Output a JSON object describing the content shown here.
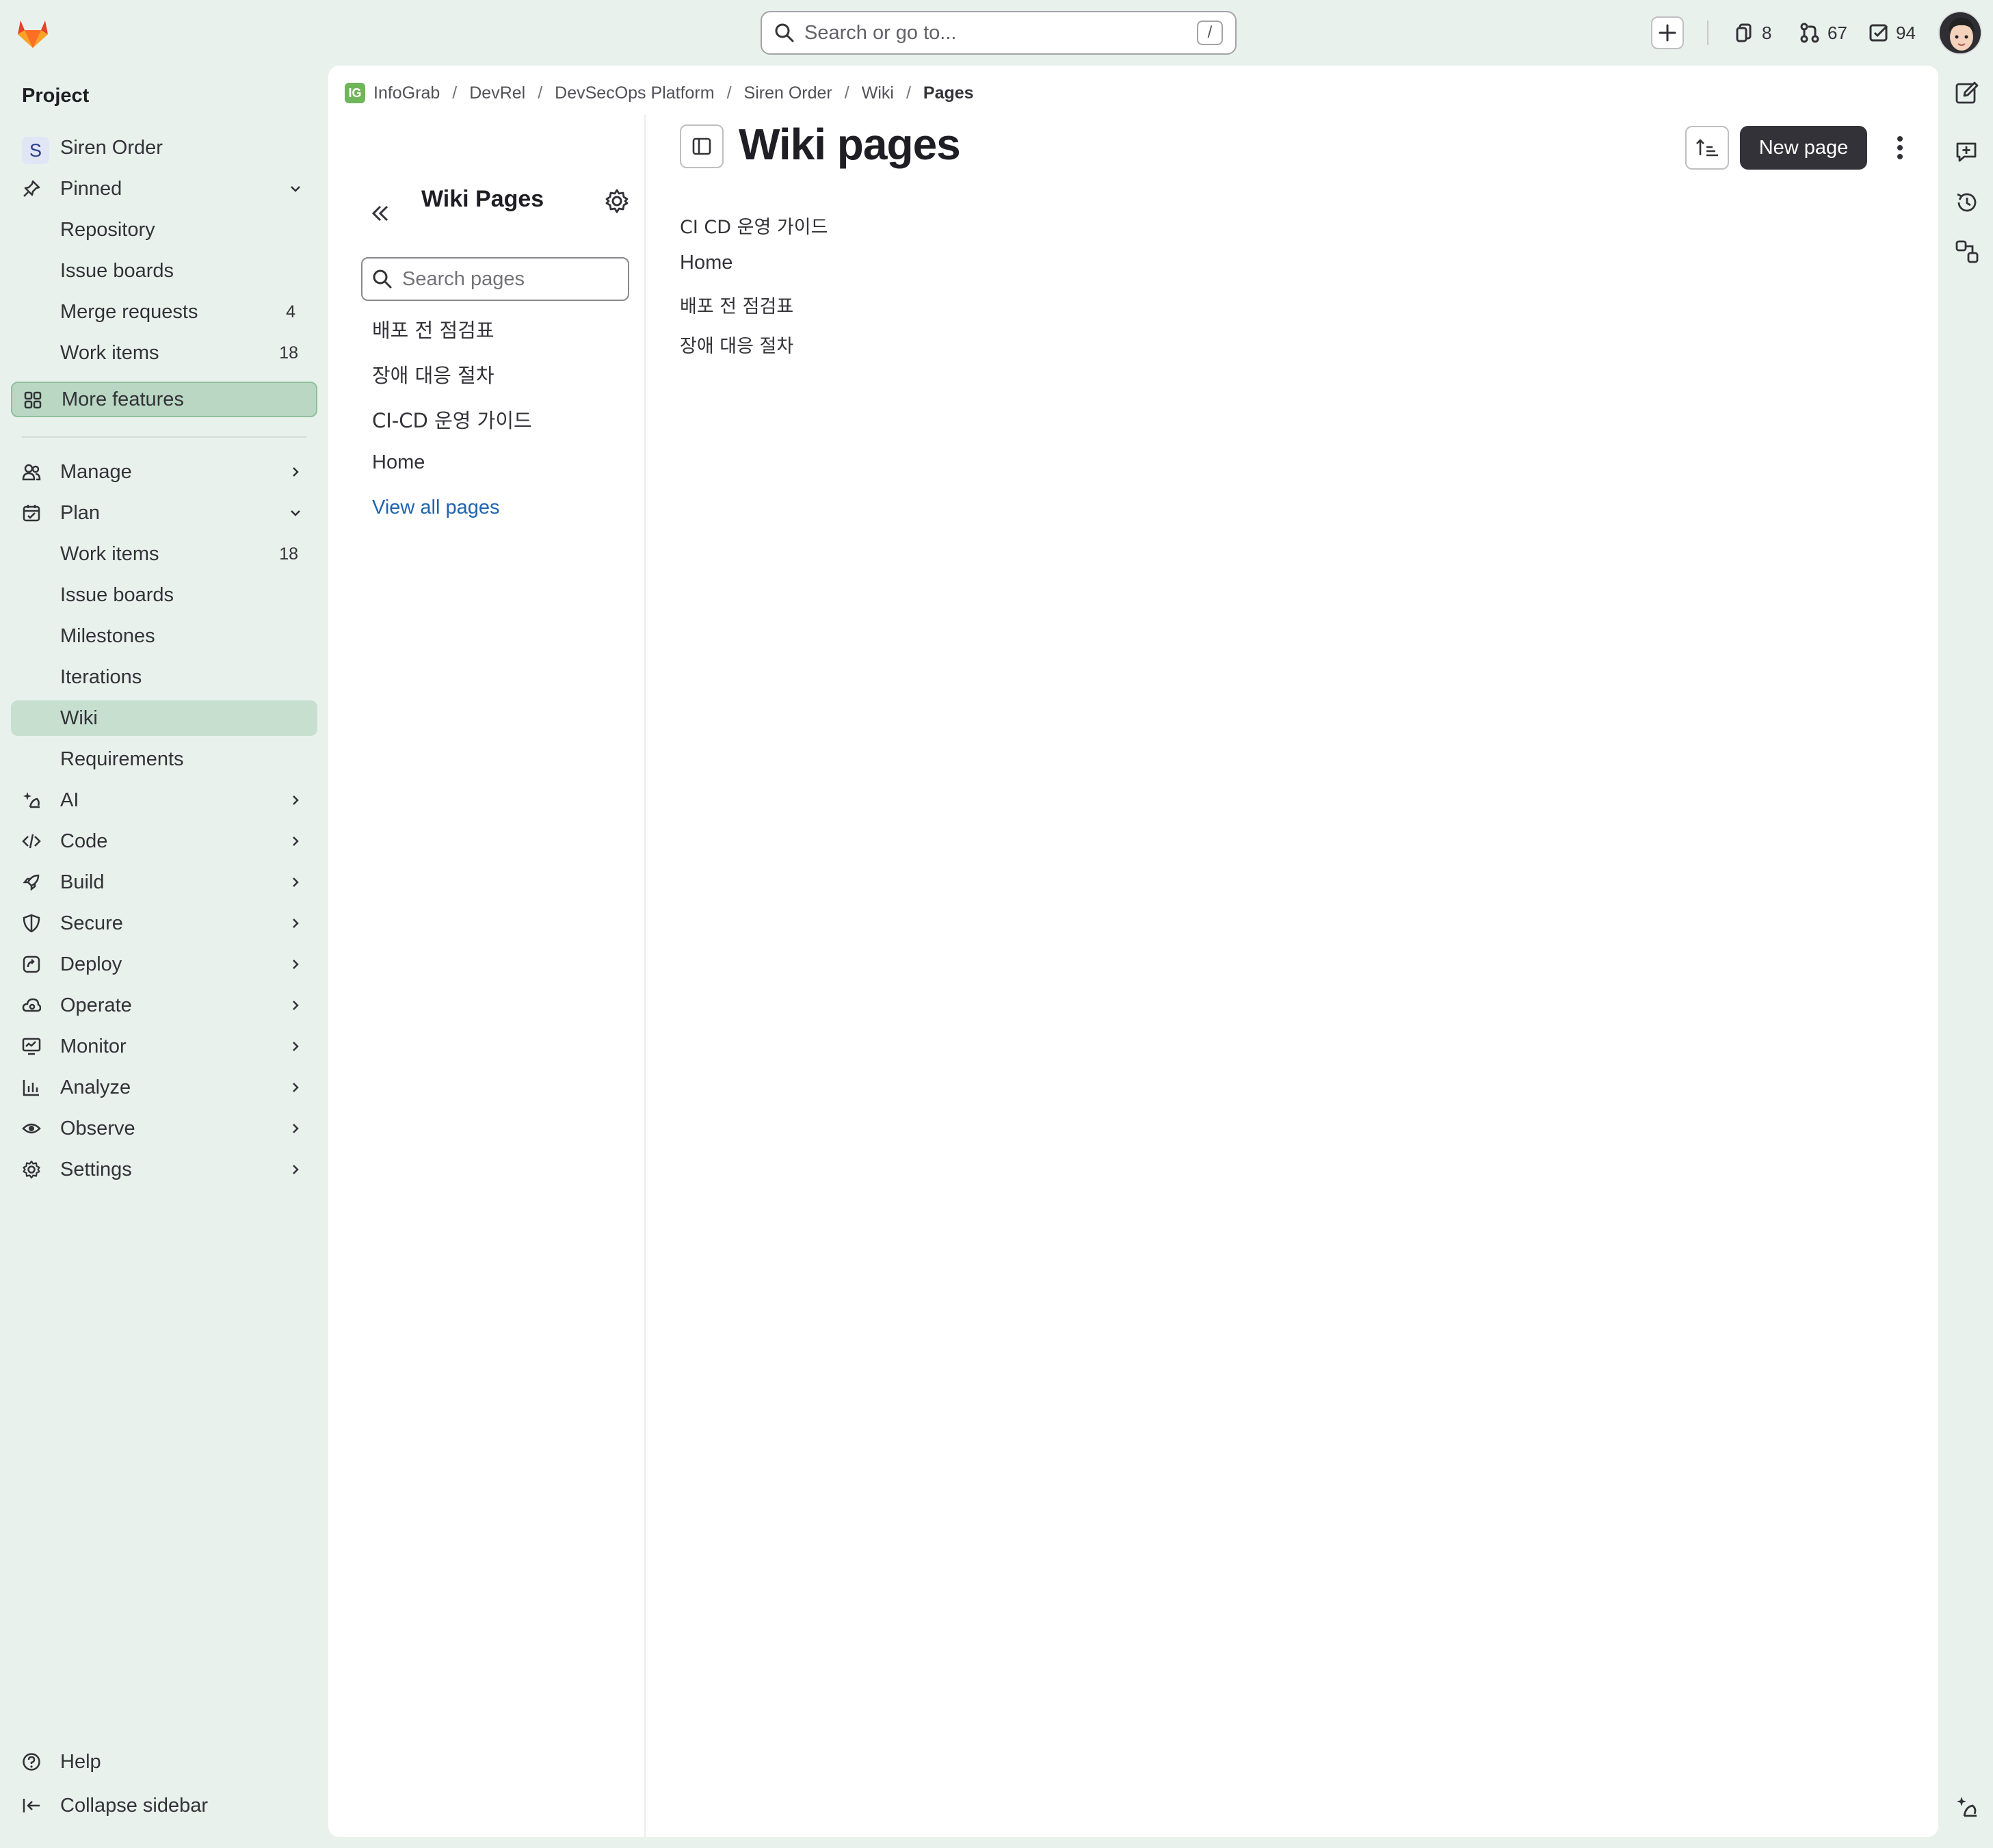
{
  "topbar": {
    "search_placeholder": "Search or go to...",
    "search_shortcut": "/",
    "counters": [
      {
        "name": "issues",
        "value": "8"
      },
      {
        "name": "merge_requests",
        "value": "67"
      },
      {
        "name": "todos",
        "value": "94"
      }
    ]
  },
  "sidebar": {
    "heading": "Project",
    "project_initial": "S",
    "project_name": "Siren Order",
    "pinned": {
      "label": "Pinned",
      "items": [
        {
          "label": "Repository",
          "count": ""
        },
        {
          "label": "Issue boards",
          "count": ""
        },
        {
          "label": "Merge requests",
          "count": "4"
        },
        {
          "label": "Work items",
          "count": "18"
        }
      ]
    },
    "more_features": "More features",
    "manage": "Manage",
    "plan": {
      "label": "Plan",
      "items": [
        {
          "label": "Work items",
          "count": "18"
        },
        {
          "label": "Issue boards",
          "count": ""
        },
        {
          "label": "Milestones",
          "count": ""
        },
        {
          "label": "Iterations",
          "count": ""
        },
        {
          "label": "Wiki",
          "count": ""
        },
        {
          "label": "Requirements",
          "count": ""
        }
      ]
    },
    "sections": [
      "AI",
      "Code",
      "Build",
      "Secure",
      "Deploy",
      "Operate",
      "Monitor",
      "Analyze",
      "Observe",
      "Settings"
    ],
    "help": "Help",
    "collapse": "Collapse sidebar"
  },
  "breadcrumb": {
    "logo_text": "IG",
    "items": [
      "InfoGrab",
      "DevRel",
      "DevSecOps Platform",
      "Siren Order",
      "Wiki"
    ],
    "current": "Pages"
  },
  "wiki_sidebar": {
    "title": "Wiki Pages",
    "search_placeholder": "Search pages",
    "pages": [
      "배포 전 점검표",
      "장애 대응 절차",
      "CI-CD 운영 가이드",
      "Home"
    ],
    "view_all": "View all pages"
  },
  "content": {
    "title": "Wiki pages",
    "new_page": "New page",
    "pages": [
      "CI CD 운영 가이드",
      "Home",
      "배포 전 점검표",
      "장애 대응 절차"
    ]
  },
  "colors": {
    "background": "#e9f1ec",
    "active_nav": "#c7dfcf",
    "primary_button": "#333238",
    "link": "#1f63b0"
  }
}
